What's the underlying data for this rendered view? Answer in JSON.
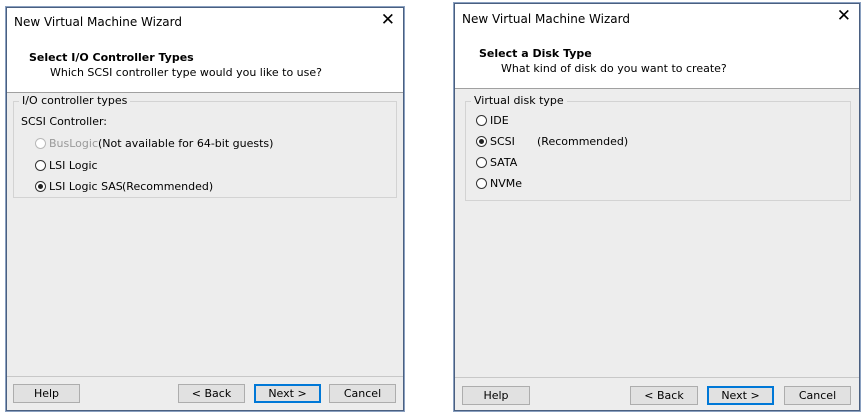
{
  "left": {
    "window_title": "New Virtual Machine Wizard",
    "close_glyph": "✕",
    "header_title": "Select I/O Controller Types",
    "header_subtitle": "Which SCSI controller type would you like to use?",
    "group_label": "I/O controller types",
    "scsi_label": "SCSI Controller:",
    "options": [
      {
        "label": "BusLogic",
        "note": "(Not available for 64-bit guests)",
        "checked": false,
        "disabled": true
      },
      {
        "label": "LSI Logic",
        "note": "",
        "checked": false,
        "disabled": false
      },
      {
        "label": "LSI Logic SAS",
        "note": "(Recommended)",
        "checked": true,
        "disabled": false
      }
    ],
    "buttons": {
      "help": "Help",
      "back": "< Back",
      "next": "Next >",
      "cancel": "Cancel"
    }
  },
  "right": {
    "window_title": "New Virtual Machine Wizard",
    "close_glyph": "✕",
    "header_title": "Select a Disk Type",
    "header_subtitle": "What kind of disk do you want to create?",
    "group_label": "Virtual disk type",
    "options": [
      {
        "label": "IDE",
        "note": "",
        "checked": false
      },
      {
        "label": "SCSI",
        "note": "(Recommended)",
        "checked": true
      },
      {
        "label": "SATA",
        "note": "",
        "checked": false
      },
      {
        "label": "NVMe",
        "note": "",
        "checked": false
      }
    ],
    "buttons": {
      "help": "Help",
      "back": "< Back",
      "next": "Next >",
      "cancel": "Cancel"
    }
  }
}
